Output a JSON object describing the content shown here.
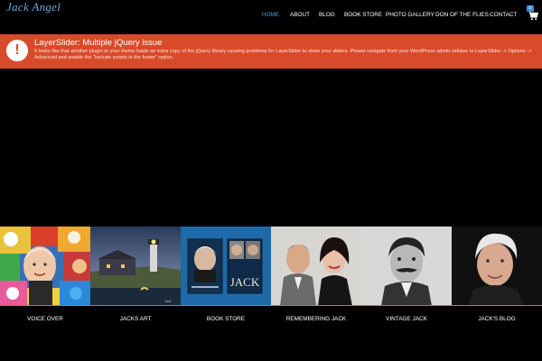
{
  "header": {
    "logo_first": "Jack",
    "logo_second": "Angel",
    "nav": [
      {
        "label": "HOME",
        "active": true
      },
      {
        "label": "ABOUT",
        "active": false
      },
      {
        "label": "BLOG",
        "active": false
      },
      {
        "label": "BOOK STORE",
        "active": false
      },
      {
        "label": "PHOTO GALLERY",
        "active": false
      },
      {
        "label": "DON OF THE FLIES",
        "active": false
      },
      {
        "label": "CONTACT",
        "active": false
      }
    ],
    "cart_count": "0"
  },
  "notice": {
    "title": "LayerSlider: Multiple jQuery issue",
    "body": "It looks like that another plugin or your theme loads an extra copy of the jQuery library causing problems for LayerSlider to show your sliders. Please navigate from your WordPress admin sidebar to LayerSlider -> Options -> Advanced and enable the \"Include scripts in the footer\" option."
  },
  "tiles": [
    {
      "label": "VOICE OVER"
    },
    {
      "label": "JACKS ART"
    },
    {
      "label": "BOOK STORE",
      "book_title": "JACK"
    },
    {
      "label": "REMEMBERING JACK"
    },
    {
      "label": "VINTAGE JACK"
    },
    {
      "label": "JACK'S BLOG"
    }
  ],
  "colors": {
    "background": "#000000",
    "accent_blue": "#4a9fe0",
    "notice_red": "#d94a2a"
  }
}
